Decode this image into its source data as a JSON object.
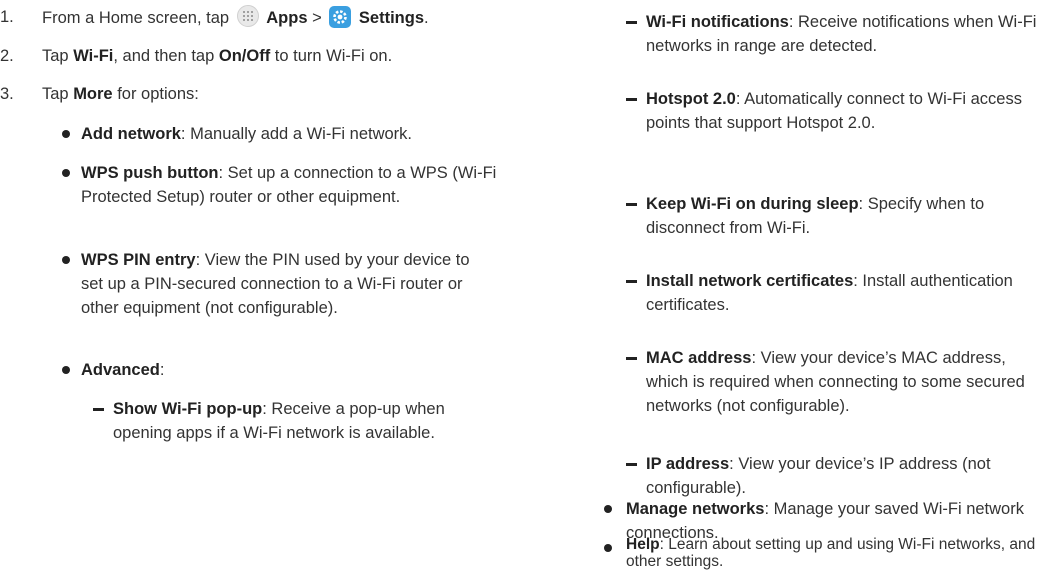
{
  "steps": [
    {
      "num": "1.",
      "pre": "From a Home screen, tap ",
      "apps": "Apps",
      "sep": " > ",
      "settings": "Settings",
      "end": "."
    },
    {
      "num": "2.",
      "t1": "Tap ",
      "b1": "Wi-Fi",
      "t2": ", and then tap ",
      "b2": "On/Off",
      "t3": " to turn Wi-Fi on."
    },
    {
      "num": "3.",
      "t1": "Tap ",
      "b1": "More",
      "t2": " for options:"
    }
  ],
  "options": [
    {
      "bold": "Add network",
      "text": ": Manually add a Wi-Fi network."
    },
    {
      "bold": "WPS push button",
      "text": ": Set up a connection to a WPS (Wi-Fi Protected Setup) router or other equipment."
    },
    {
      "bold": "WPS PIN entry",
      "text": ": View the PIN used by your device to set up a PIN-secured connection to a Wi-Fi router or other equipment (not configurable)."
    },
    {
      "bold": "Advanced",
      "text": ":"
    },
    {
      "bold": "Manage networks",
      "text": ": Manage your saved Wi-Fi network connections."
    },
    {
      "bold": "Help",
      "text": ": Learn about setting up and using Wi-Fi networks, and other settings."
    }
  ],
  "advanced": [
    {
      "bold": "Show Wi-Fi pop-up",
      "text": ": Receive a pop-up when opening apps if a Wi-Fi network is available."
    },
    {
      "bold": "Wi-Fi notifications",
      "text": ": Receive notifications when Wi-Fi networks in range are detected."
    },
    {
      "bold": "Hotspot 2.0",
      "text": ": Automatically connect to Wi-Fi access points that support Hotspot 2.0."
    },
    {
      "bold": "Keep Wi-Fi on during sleep",
      "text": ": Specify when to disconnect from Wi-Fi."
    },
    {
      "bold": "Install network certificates",
      "text": ": Install authentication certificates."
    },
    {
      "bold": "MAC address",
      "text": ": View your device’s MAC address, which is required when connecting to some secured networks (not configurable)."
    },
    {
      "bold": "IP address",
      "text": ": View your device’s IP address (not configurable)."
    }
  ]
}
